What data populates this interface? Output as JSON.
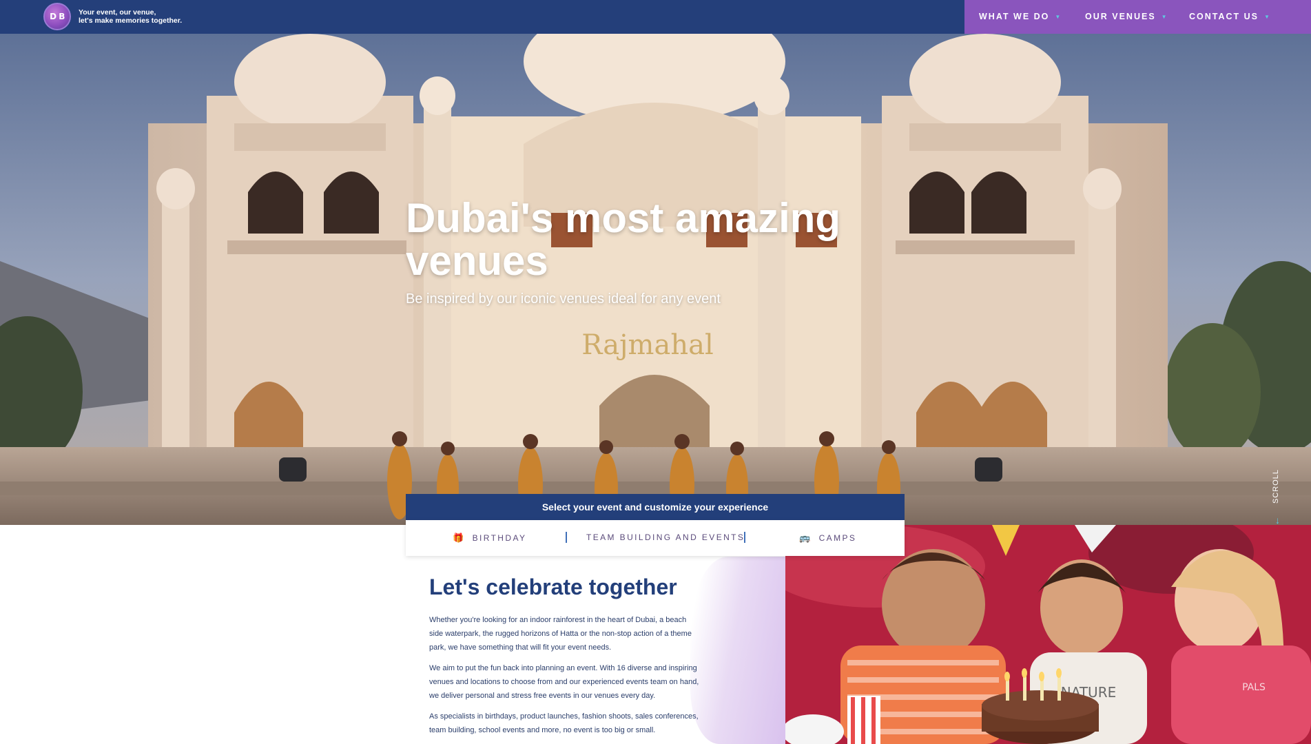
{
  "header": {
    "logo_text": "D B",
    "tagline_line1": "Your event, our venue,",
    "tagline_line2": "let's make memories together.",
    "nav": [
      {
        "label": "WHAT WE DO"
      },
      {
        "label": "OUR VENUES"
      },
      {
        "label": "CONTACT US"
      }
    ],
    "colors": {
      "bar": "#243f7a",
      "nav_panel": "#8a55bd",
      "chevron": "#5fc9e0"
    }
  },
  "hero": {
    "title": "Dubai's most amazing venues",
    "subtitle": "Be inspired by our iconic venues ideal for any event",
    "sign_text": "Rajmahal",
    "scroll_label": "SCROLL"
  },
  "event_selector": {
    "heading": "Select your event and customize your experience",
    "options": [
      {
        "label": "BIRTHDAY",
        "icon": "gift-icon"
      },
      {
        "label": "TEAM BUILDING AND EVENTS",
        "icon": ""
      },
      {
        "label": "CAMPS",
        "icon": "bus-icon"
      }
    ]
  },
  "intro": {
    "title": "Let's celebrate together",
    "paragraphs": [
      "Whether you're looking for an indoor rainforest in the heart of Dubai, a beach side waterpark, the rugged horizons of Hatta or the non-stop action of a theme park, we have something that will fit your event needs.",
      "We aim to put the fun back into planning an event. With 16 diverse and inspiring venues and locations to choose from and our experienced events team on hand, we deliver personal and stress free events in our venues every day.",
      "As specialists in birthdays, product launches, fashion shoots, sales conferences, team building, school events and more, no event is too big or small."
    ]
  },
  "photo": {
    "shirt_text_1": "NATURE",
    "shirt_text_2": "PALS"
  }
}
